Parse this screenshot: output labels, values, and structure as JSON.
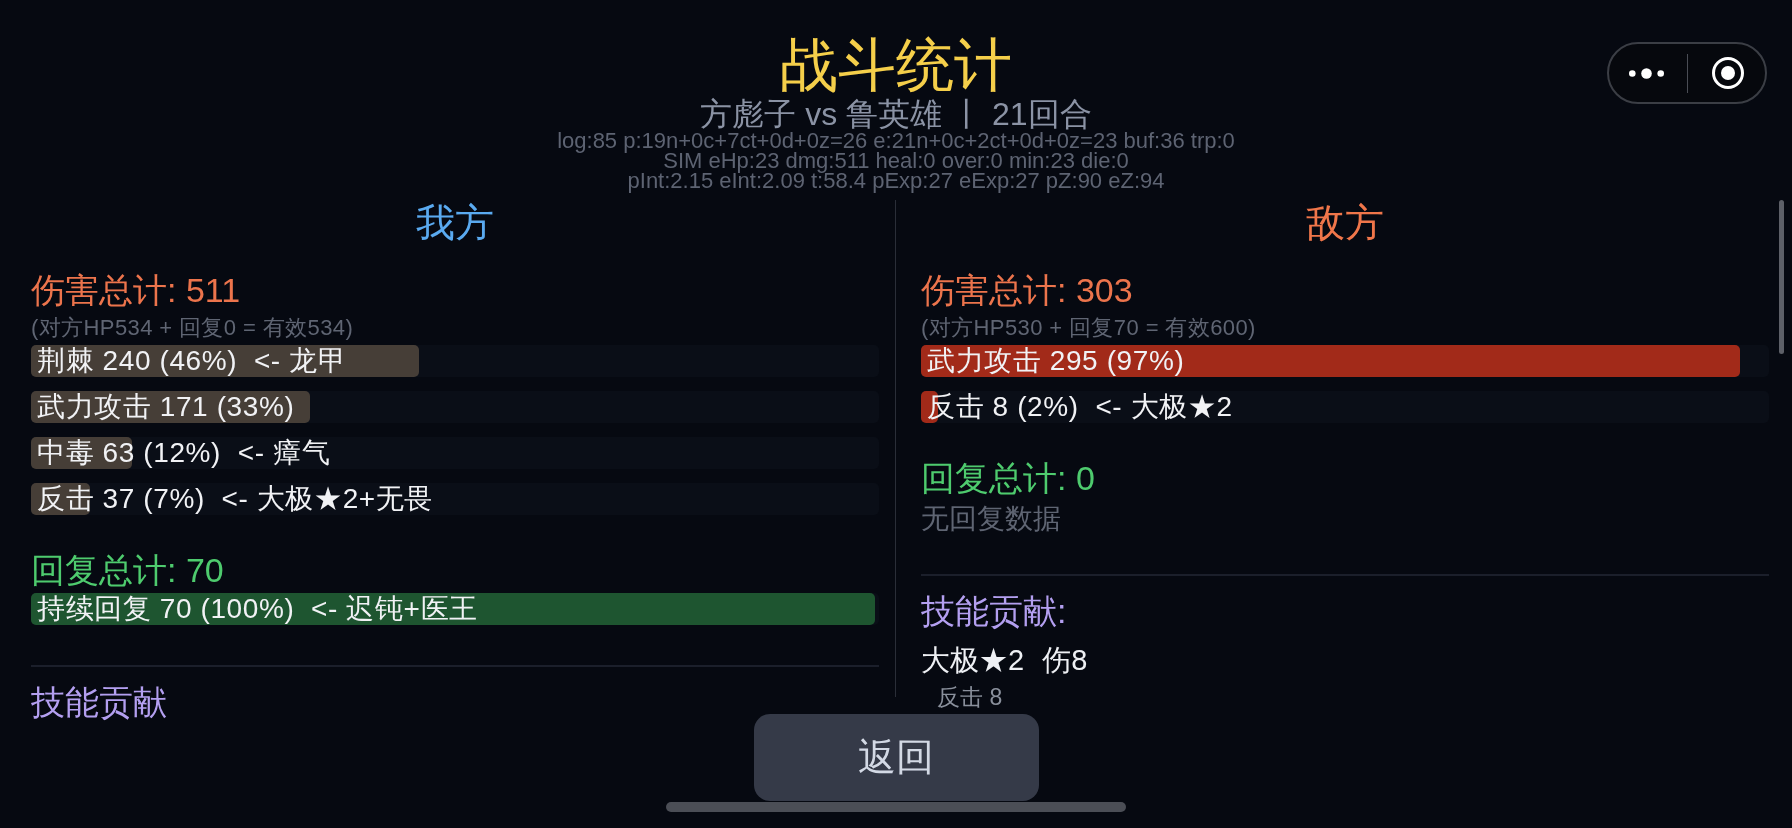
{
  "header": {
    "title": "战斗统计",
    "subtitle": "方彪子 vs 鲁英雄 丨 21回合",
    "debug_lines": [
      "log:85 p:19n+0c+7ct+0d+0z=26 e:21n+0c+2ct+0d+0z=23 buf:36 trp:0",
      "SIM eHp:23 dmg:511 heal:0 over:0 min:23 die:0",
      "pInt:2.15 eInt:2.09 t:58.4 pExp:27 eExp:27 pZ:90 eZ:94"
    ]
  },
  "sides": [
    {
      "kind": "ally",
      "title": "我方",
      "damage": {
        "heading": "伤害总计: 511",
        "note": "(对方HP534 + 回复0 = 有效534)",
        "entries": [
          {
            "text": "荆棘 240 (46%)  <- 龙甲",
            "level": 0.46
          },
          {
            "text": "武力攻击 171 (33%)",
            "level": 0.33
          },
          {
            "text": "中毒 63 (12%)  <- 瘴气",
            "level": 0.12
          },
          {
            "text": "反击 37 (7%)  <- 大极★2+无畏",
            "level": 0.07
          }
        ]
      },
      "healing": {
        "heading": "回复总计: 70",
        "entries": [
          {
            "text": "持续回复 70 (100%)  <- 迟钝+医王",
            "level": 1
          }
        ]
      },
      "skills": {
        "heading": "技能贡献"
      }
    },
    {
      "kind": "enemy",
      "title": "敌方",
      "damage": {
        "heading": "伤害总计: 303",
        "note": "(对方HP530 + 回复70 = 有效600)",
        "entries": [
          {
            "text": "武力攻击 295 (97%)",
            "level": 0.97
          },
          {
            "text": "反击 8 (2%)  <- 大极★2",
            "level": 0.02
          }
        ]
      },
      "healing": {
        "heading": "回复总计: 0",
        "empty_text": "无回复数据"
      },
      "skills": {
        "heading": "技能贡献:",
        "rows": [
          {
            "skill": "大极★2",
            "total": "伤8",
            "details": [
              "反击 8"
            ]
          }
        ]
      }
    }
  ],
  "back_button": "返回"
}
